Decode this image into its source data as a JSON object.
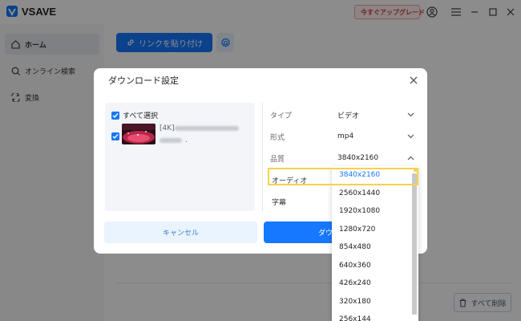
{
  "app": {
    "title": "VSAVE",
    "upgrade_label": "今すぐアップグレード",
    "accent_color": "#1677ff"
  },
  "sidebar": {
    "items": [
      {
        "label": "ホーム",
        "icon": "home-icon",
        "active": true
      },
      {
        "label": "オンライン検索",
        "icon": "search-icon",
        "active": false
      },
      {
        "label": "変換",
        "icon": "convert-icon",
        "active": false
      }
    ]
  },
  "main": {
    "paste_link_label": "リンクを貼り付け",
    "delete_all_label": "すべて削除"
  },
  "dialog": {
    "title": "ダウンロード設定",
    "select_all_label": "すべて選択",
    "item_resolution_tag": "[4K]",
    "item_suffix": ".",
    "options": {
      "type_label": "タイプ",
      "type_value": "ビデオ",
      "format_label": "形式",
      "format_value": "mp4",
      "quality_label": "品質",
      "quality_value": "3840x2160",
      "audio_label": "オーディオ",
      "subtitle_label": "字幕"
    },
    "cancel_label": "キャンセル",
    "download_label": "ダウ"
  },
  "quality_dropdown": {
    "selected": "3840x2160",
    "options": [
      "3840x2160",
      "2560x1440",
      "1920x1080",
      "1280x720",
      "854x480",
      "640x360",
      "426x240",
      "320x180",
      "256x144"
    ]
  }
}
